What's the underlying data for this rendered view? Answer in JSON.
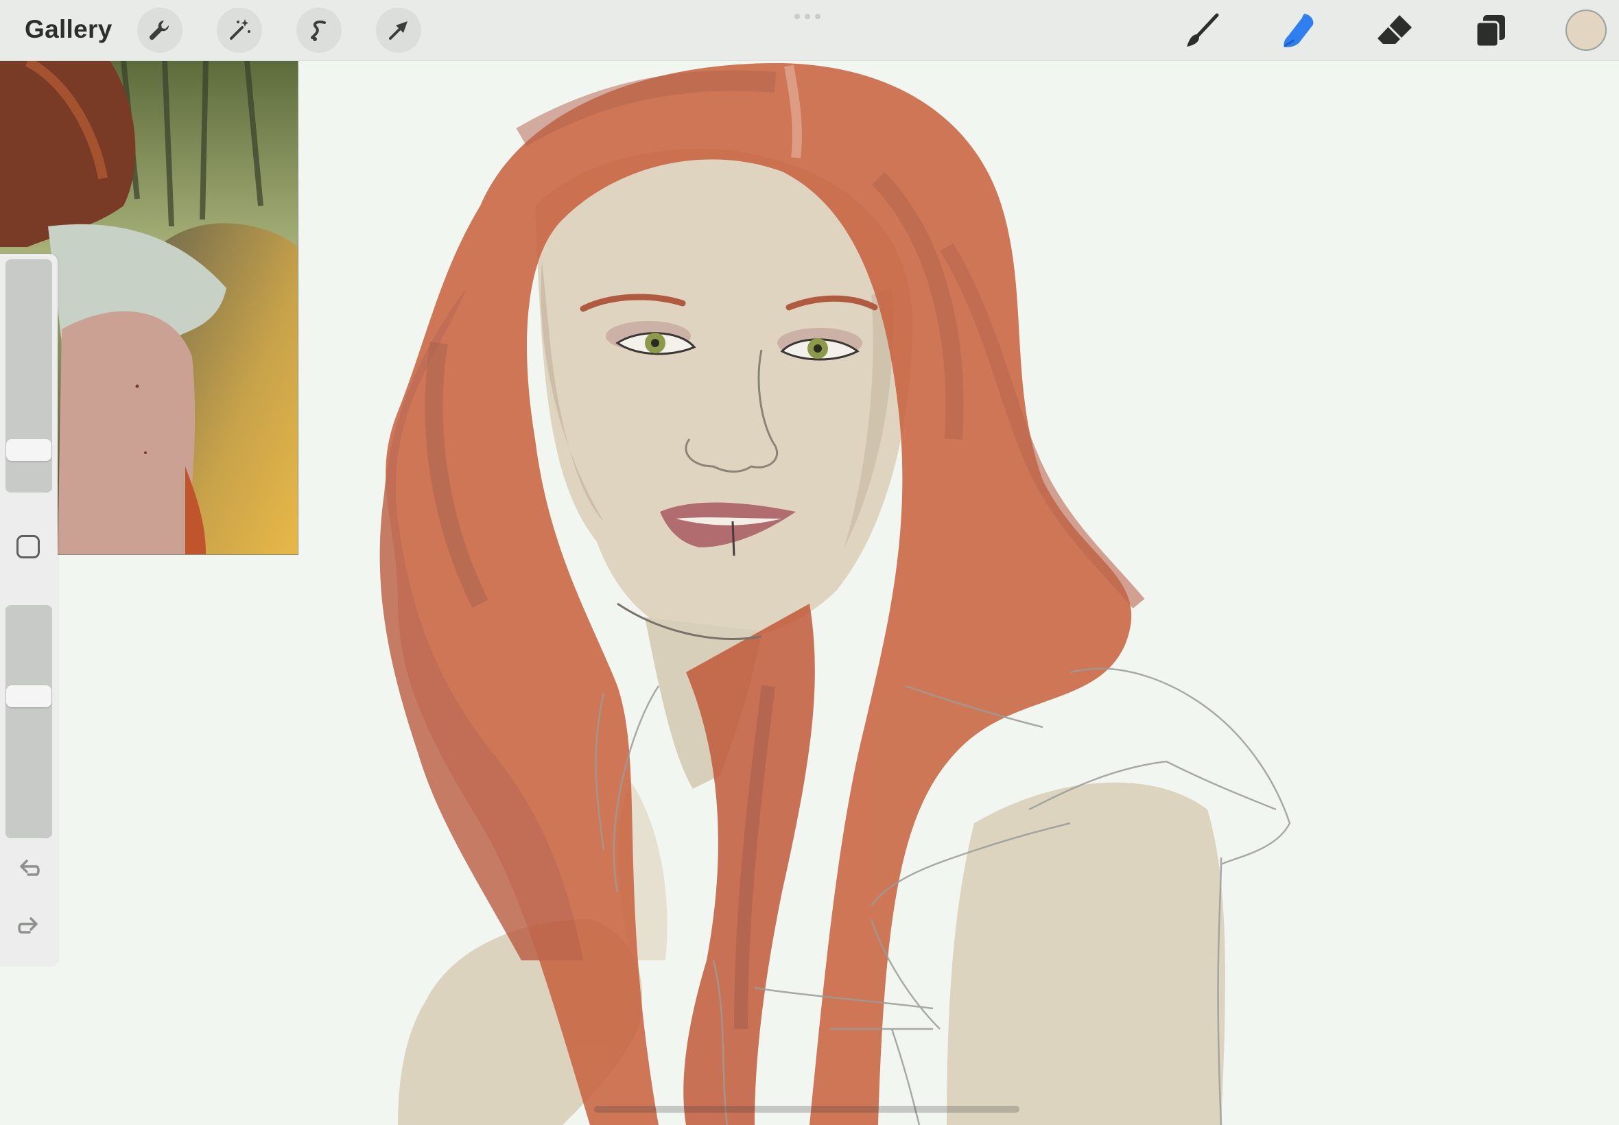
{
  "toolbar": {
    "gallery_label": "Gallery",
    "left_tools": [
      {
        "icon": "wrench-icon",
        "name": "actions"
      },
      {
        "icon": "magic-wand-icon",
        "name": "adjustments"
      },
      {
        "icon": "selection-s-icon",
        "name": "selection"
      },
      {
        "icon": "arrow-cursor-icon",
        "name": "transform"
      }
    ],
    "right_tools": [
      {
        "icon": "brush-icon",
        "name": "paint",
        "active": false
      },
      {
        "icon": "smudge-icon",
        "name": "smudge",
        "active": true
      },
      {
        "icon": "eraser-icon",
        "name": "eraser",
        "active": false
      },
      {
        "icon": "layers-icon",
        "name": "layers",
        "active": false
      }
    ],
    "active_color": "#e2d5c1",
    "accent_color": "#2f7ff0"
  },
  "sidebar": {
    "brush_size_level": 0.15,
    "opacity_level": 0.62,
    "modify_icon": "square-modify-icon",
    "undo_icon": "undo-icon",
    "redo_icon": "redo-icon"
  },
  "canvas": {
    "background_color": "#f2f6f1",
    "reference_image": "photo-reference"
  }
}
